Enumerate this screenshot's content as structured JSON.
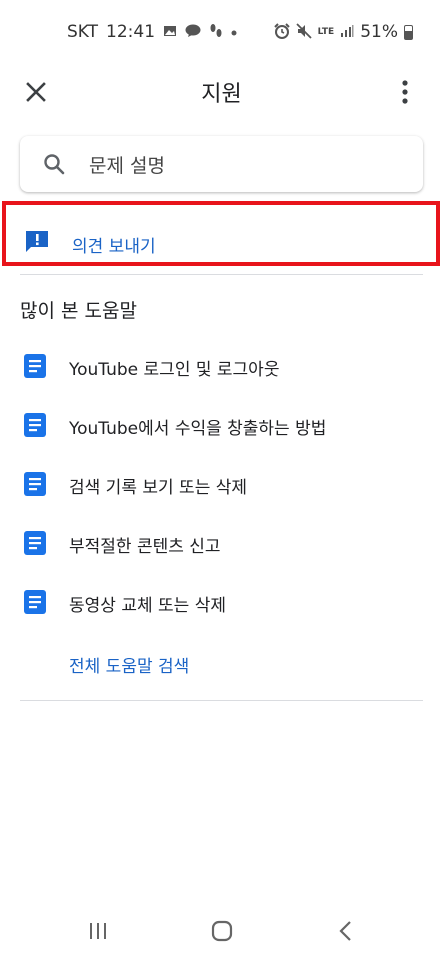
{
  "status_bar": {
    "carrier": "SKT",
    "time": "12:41",
    "network": "LTE",
    "battery": "51%"
  },
  "app_bar": {
    "title": "지원"
  },
  "search": {
    "placeholder": "문제 설명"
  },
  "feedback": {
    "label": "의견 보내기"
  },
  "popular": {
    "title": "많이 본 도움말",
    "items": [
      {
        "label": "YouTube 로그인 및 로그아웃"
      },
      {
        "label": "YouTube에서 수익을 창출하는 방법"
      },
      {
        "label": "검색 기록 보기 또는 삭제"
      },
      {
        "label": "부적절한 콘텐츠 신고"
      },
      {
        "label": "동영상 교체 또는 삭제"
      }
    ],
    "all_help_label": "전체 도움말 검색"
  },
  "colors": {
    "accent": "#1a63c6",
    "highlight_border": "#e8141b",
    "doc_icon": "#1a73e8"
  }
}
